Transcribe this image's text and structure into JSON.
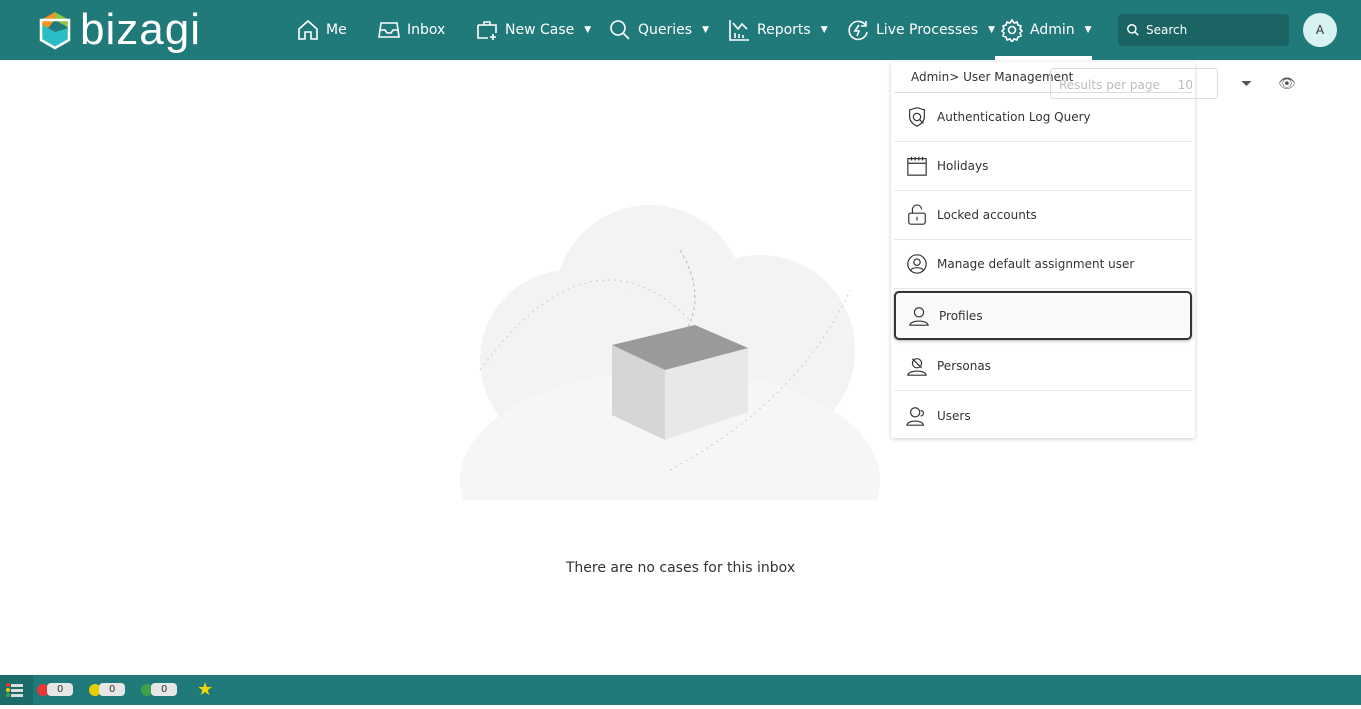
{
  "header": {
    "logo": "bizagi",
    "nav": [
      {
        "label": "Me",
        "icon": "home-icon"
      },
      {
        "label": "Inbox",
        "icon": "inbox-icon"
      },
      {
        "label": "New Case",
        "icon": "new-case-icon",
        "dropdown": true
      },
      {
        "label": "Queries",
        "icon": "search-icon",
        "dropdown": true
      },
      {
        "label": "Reports",
        "icon": "chart-icon",
        "dropdown": true
      },
      {
        "label": "Live Processes",
        "icon": "live-process-icon",
        "dropdown": true
      },
      {
        "label": "Admin",
        "icon": "gear-icon",
        "dropdown": true,
        "active": true
      }
    ],
    "search_placeholder": "Search",
    "avatar": "A",
    "color": "#217a7a"
  },
  "toolbar": {
    "results_label": "Results per page",
    "results_value": "10"
  },
  "admin_menu": {
    "breadcrumb": "Admin> User Management",
    "items": [
      {
        "label": "Authentication Log Query",
        "icon": "shield-search-icon"
      },
      {
        "label": "Holidays",
        "icon": "calendar-icon"
      },
      {
        "label": "Locked accounts",
        "icon": "lock-icon"
      },
      {
        "label": "Manage default assignment user",
        "icon": "user-circle-icon"
      },
      {
        "label": "Profiles",
        "icon": "user-icon",
        "selected": true
      },
      {
        "label": "Personas",
        "icon": "personas-icon"
      },
      {
        "label": "Users",
        "icon": "users-icon"
      }
    ]
  },
  "main": {
    "empty_message": "There are no cases for this inbox"
  },
  "footer": {
    "counters": [
      {
        "color": "#e53935",
        "value": "0"
      },
      {
        "color": "#e6cf00",
        "value": "0"
      },
      {
        "color": "#43a047",
        "value": "0"
      }
    ]
  }
}
